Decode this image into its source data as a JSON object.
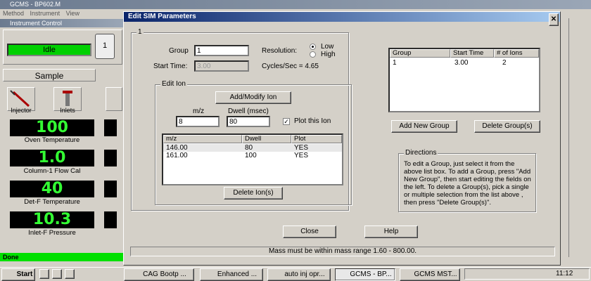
{
  "background_app": {
    "title": "GCMS - BP602.M",
    "menu": [
      "Method",
      "Instrument",
      "View"
    ],
    "instrument_control_title": "Instrument Control",
    "status": "Idle",
    "vial_number": "1",
    "sample_tab": "Sample",
    "tools": [
      "Injector",
      "Inlets"
    ],
    "readouts": [
      {
        "value": "100",
        "label": "Oven Temperature"
      },
      {
        "value": "1.0",
        "label": "Column-1 Flow Cal"
      },
      {
        "value": "40",
        "label": "Det-F Temperature"
      },
      {
        "value": "10.3",
        "label": "Inlet-F Pressure"
      }
    ],
    "status_bar": "Done"
  },
  "dialog": {
    "title": "Edit SIM Parameters",
    "close_icon": "close-icon",
    "groupbox_label": "1",
    "group_label": "Group",
    "group_value": "1",
    "start_time_label": "Start Time:",
    "start_time_value": "3.00",
    "resolution_label": "Resolution:",
    "resolution_options": [
      "Low",
      "High"
    ],
    "resolution_selected": "Low",
    "cycles_label": "Cycles/Sec =",
    "cycles_value": "4.65",
    "edit_ion": {
      "label": "Edit Ion",
      "add_modify_button": "Add/Modify Ion",
      "mz_label": "m/z",
      "mz_value": "8",
      "dwell_label": "Dwell (msec)",
      "dwell_value": "80",
      "plot_label": "Plot this Ion",
      "plot_checked": true,
      "columns": [
        "m/z",
        "Dwell",
        "Plot"
      ],
      "rows": [
        [
          "146.00",
          "80",
          "YES"
        ],
        [
          "161.00",
          "100",
          "YES"
        ]
      ],
      "delete_button": "Delete Ion(s)"
    },
    "groups_list": {
      "columns": [
        "Group",
        "Start Time",
        "# of Ions"
      ],
      "rows": [
        [
          "1",
          "3.00",
          "2"
        ]
      ]
    },
    "add_group_button": "Add New Group",
    "delete_group_button": "Delete Group(s)",
    "directions": {
      "label": "Directions",
      "text": "To edit a Group, just select it from the above list box. To add a Group, press \"Add New Group\", then start editing the fields on the left. To delete a Group(s), pick a single or multiple selection from the list above , then press \"Delete Group(s)\"."
    },
    "close_button": "Close",
    "help_button": "Help",
    "status_message": "Mass must be within mass range 1.60  -  800.00."
  },
  "taskbar": {
    "start": "Start",
    "tasks": [
      "CAG Bootp ...",
      "Enhanced ...",
      "auto inj opr...",
      "GCMS - BP...",
      "GCMS MST..."
    ],
    "clock": "11:12"
  }
}
